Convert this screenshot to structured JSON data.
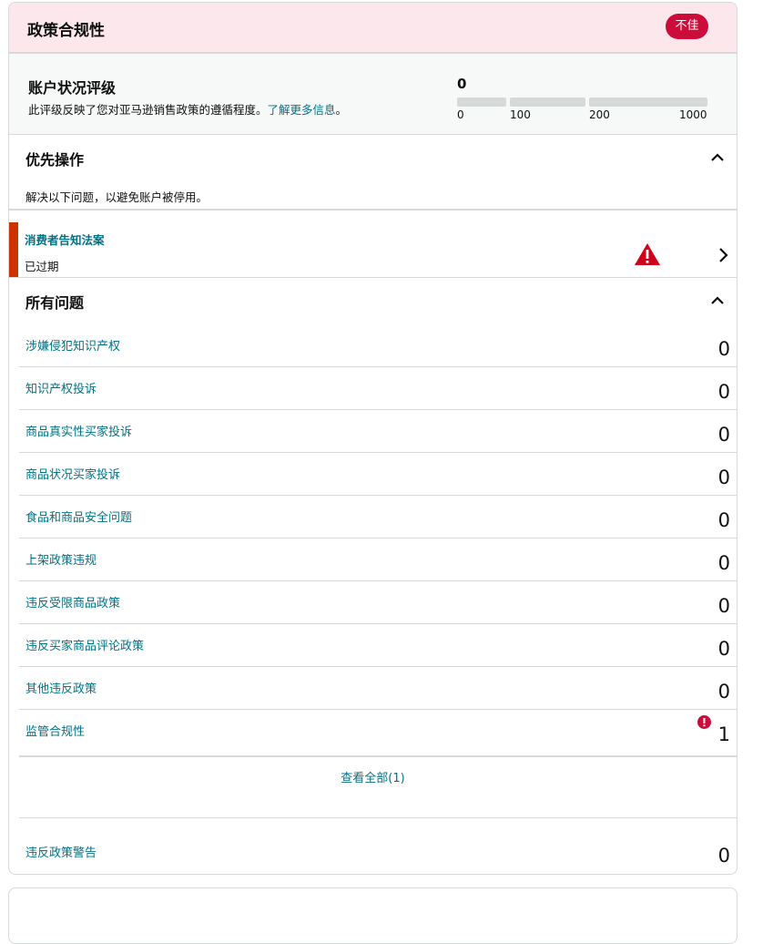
{
  "card": {
    "title": "政策合规性",
    "status_badge": "不佳"
  },
  "rating": {
    "title": "账户状况评级",
    "description": "此评级反映了您对亚马逊销售政策的遵循程度。",
    "learn_more": "了解更多信息",
    "desc_end": "。",
    "score": "0",
    "ticks": [
      "0",
      "100",
      "200",
      "1000"
    ],
    "score_fraction": 0
  },
  "priority": {
    "title": "优先操作",
    "description": "解决以下问题，以避免账户被停用。",
    "item": {
      "name": "消费者告知法案",
      "status": "已过期"
    }
  },
  "issues": {
    "title": "所有问题",
    "rows": [
      {
        "label": "涉嫌侵犯知识产权",
        "count": "0"
      },
      {
        "label": "知识产权投诉",
        "count": "0"
      },
      {
        "label": "商品真实性买家投诉",
        "count": "0"
      },
      {
        "label": "商品状况买家投诉",
        "count": "0"
      },
      {
        "label": "食品和商品安全问题",
        "count": "0"
      },
      {
        "label": "上架政策违规",
        "count": "0"
      },
      {
        "label": "违反受限商品政策",
        "count": "0"
      },
      {
        "label": "违反买家商品评论政策",
        "count": "0"
      },
      {
        "label": "其他违反政策",
        "count": "0"
      },
      {
        "label": "监管合规性",
        "count": "1"
      }
    ],
    "view_all": "查看全部(1)",
    "warnings": {
      "label": "违反政策警告",
      "count": "0"
    }
  },
  "colors": {
    "header_bg": "#fce8ec",
    "badge": "#cc0c39",
    "link": "#007185",
    "accent": "#cc3300",
    "warning_icon": "#d0021b"
  }
}
